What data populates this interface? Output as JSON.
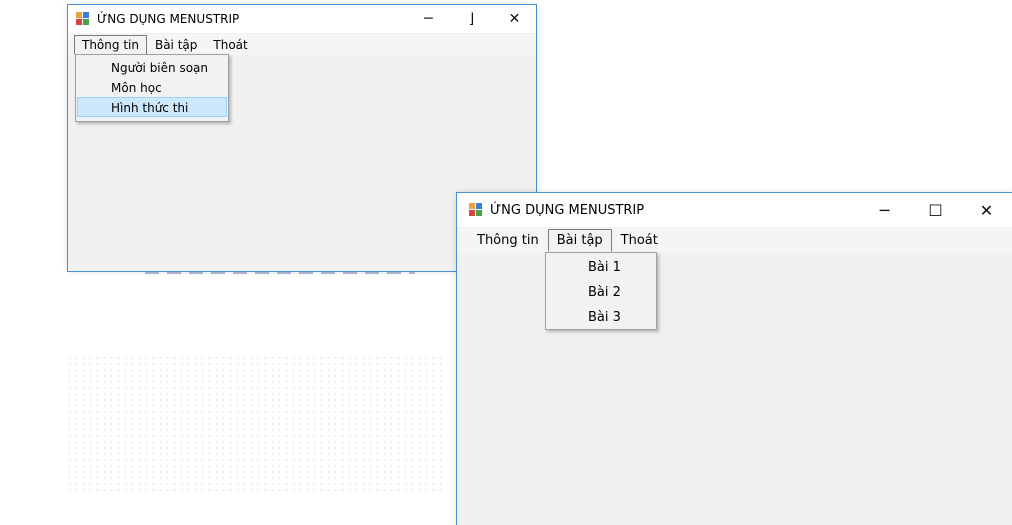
{
  "window1": {
    "title": "ỨNG DỤNG MENUSTRIP",
    "controls": {
      "minimize": "─",
      "maximize": "⌋",
      "close": "✕"
    },
    "menu": [
      "Thông tin",
      "Bài tập",
      "Thoát"
    ],
    "open_menu": "Thông tin",
    "dropdown": [
      "Người biên soạn",
      "Môn học",
      "Hình thức thi"
    ],
    "highlighted_item": "Hình thức thi"
  },
  "window2": {
    "title": "ỨNG DỤNG MENUSTRIP",
    "controls": {
      "minimize": "─",
      "maximize": "☐",
      "close": "✕"
    },
    "menu": [
      "Thông tin",
      "Bài tập",
      "Thoát"
    ],
    "open_menu": "Bài tập",
    "dropdown": [
      "Bài 1",
      "Bài 2",
      "Bài 3"
    ]
  },
  "colors": {
    "window_border": "#4a90d9",
    "client_bg": "#f0f0f0",
    "highlight_bg": "#cce8ff",
    "highlight_border": "#99d1ff"
  },
  "icons": {
    "app": "windows-form-icon"
  }
}
